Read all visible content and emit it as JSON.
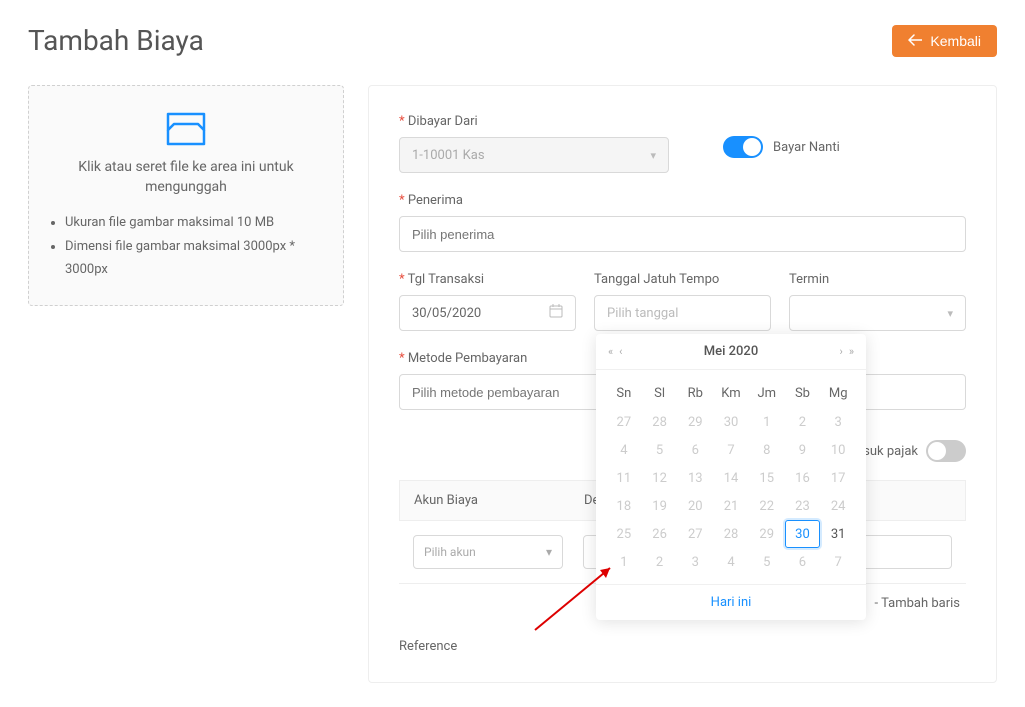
{
  "header": {
    "title": "Tambah Biaya",
    "back_label": "Kembali"
  },
  "upload": {
    "text": "Klik atau seret file ke area ini untuk mengunggah",
    "hint1": "Ukuran file gambar maksimal 10 MB",
    "hint2": "Dimensi file gambar maksimal 3000px * 3000px"
  },
  "form": {
    "dibayar_dari_label": "Dibayar Dari",
    "dibayar_dari_value": "1-10001 Kas",
    "bayar_nanti_label": "Bayar Nanti",
    "penerima_label": "Penerima",
    "penerima_placeholder": "Pilih penerima",
    "tgl_transaksi_label": "Tgl Transaksi",
    "tgl_transaksi_value": "30/05/2020",
    "tgl_jatuh_tempo_label": "Tanggal Jatuh Tempo",
    "tgl_jatuh_tempo_placeholder": "Pilih tanggal",
    "termin_label": "Termin",
    "metode_label": "Metode Pembayaran",
    "metode_placeholder": "Pilih metode pembayaran",
    "pajak_label": "asuk pajak",
    "akun_biaya_label": "Akun Biaya",
    "deskripsi_label": "Des",
    "pilih_akun_placeholder": "Pilih akun",
    "tambah_baris_label": "Tambah baris",
    "reference_label": "Reference"
  },
  "datepicker": {
    "month_title": "Mei 2020",
    "today_label": "Hari ini",
    "weekdays": [
      "Sn",
      "Sl",
      "Rb",
      "Km",
      "Jm",
      "Sb",
      "Mg"
    ],
    "weeks": [
      [
        {
          "d": "27",
          "out": true
        },
        {
          "d": "28",
          "out": true
        },
        {
          "d": "29",
          "out": true
        },
        {
          "d": "30",
          "out": true
        },
        {
          "d": "1",
          "out": true
        },
        {
          "d": "2",
          "out": true
        },
        {
          "d": "3",
          "out": true
        }
      ],
      [
        {
          "d": "4",
          "out": true
        },
        {
          "d": "5",
          "out": true
        },
        {
          "d": "6",
          "out": true
        },
        {
          "d": "7",
          "out": true
        },
        {
          "d": "8",
          "out": true
        },
        {
          "d": "9",
          "out": true
        },
        {
          "d": "10",
          "out": true
        }
      ],
      [
        {
          "d": "11",
          "out": true
        },
        {
          "d": "12",
          "out": true
        },
        {
          "d": "13",
          "out": true
        },
        {
          "d": "14",
          "out": true
        },
        {
          "d": "15",
          "out": true
        },
        {
          "d": "16",
          "out": true
        },
        {
          "d": "17",
          "out": true
        }
      ],
      [
        {
          "d": "18",
          "out": true
        },
        {
          "d": "19",
          "out": true
        },
        {
          "d": "20",
          "out": true
        },
        {
          "d": "21",
          "out": true
        },
        {
          "d": "22",
          "out": true
        },
        {
          "d": "23",
          "out": true
        },
        {
          "d": "24",
          "out": true
        }
      ],
      [
        {
          "d": "25",
          "out": true
        },
        {
          "d": "26",
          "out": true
        },
        {
          "d": "27",
          "out": true
        },
        {
          "d": "28",
          "out": true
        },
        {
          "d": "29",
          "out": true
        },
        {
          "d": "30",
          "sel": true
        },
        {
          "d": "31"
        }
      ],
      [
        {
          "d": "1",
          "out": true
        },
        {
          "d": "2",
          "out": true
        },
        {
          "d": "3",
          "out": true
        },
        {
          "d": "4",
          "out": true
        },
        {
          "d": "5",
          "out": true
        },
        {
          "d": "6",
          "out": true
        },
        {
          "d": "7",
          "out": true
        }
      ]
    ]
  }
}
